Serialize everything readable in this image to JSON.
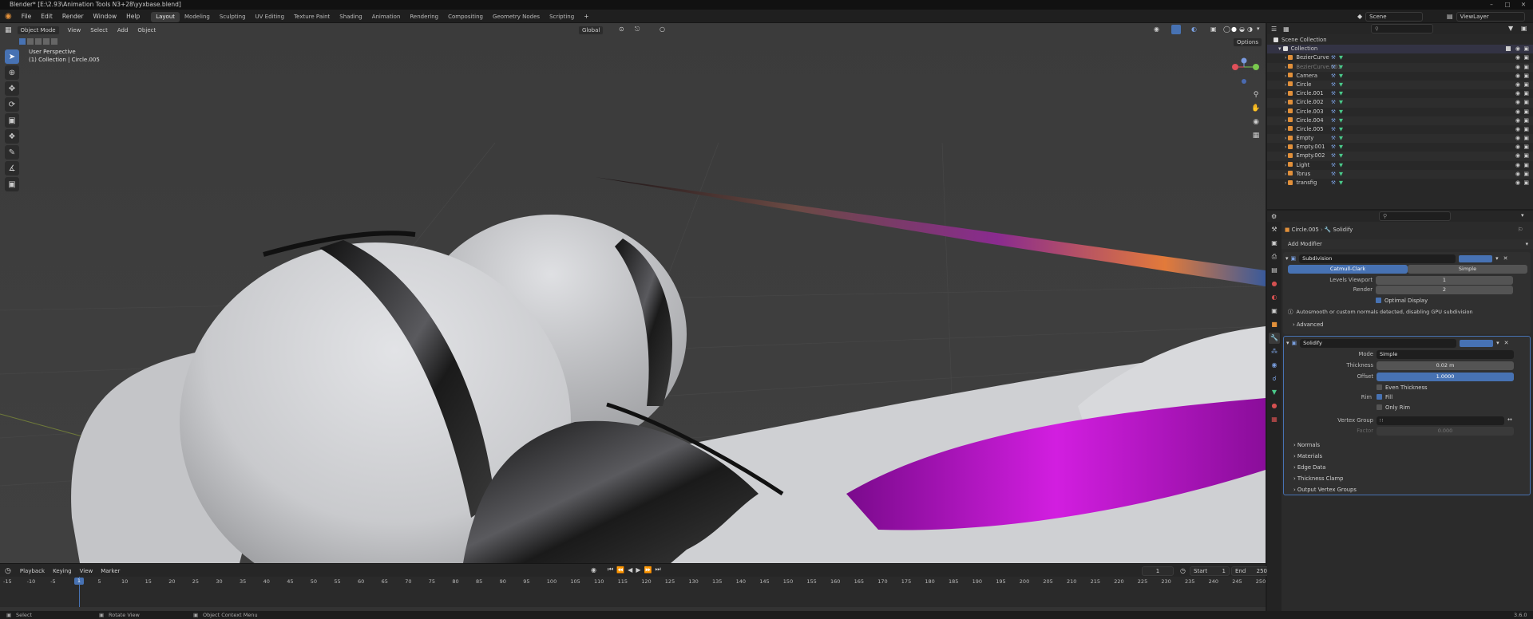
{
  "title": "Blender* [E:\\2.93\\Animation Tools N3+28\\yyxbase.blend]",
  "menu": [
    "File",
    "Edit",
    "Render",
    "Window",
    "Help"
  ],
  "workspaces": [
    "Layout",
    "Modeling",
    "Sculpting",
    "UV Editing",
    "Texture Paint",
    "Shading",
    "Animation",
    "Rendering",
    "Compositing",
    "Geometry Nodes",
    "Scripting"
  ],
  "active_workspace": "Layout",
  "scene": "Scene",
  "view_layer": "ViewLayer",
  "viewport": {
    "mode": "Object Mode",
    "menus": [
      "View",
      "Select",
      "Add",
      "Object"
    ],
    "orientation": "Global",
    "perspective": "User Perspective",
    "collection_info": "(1) Collection | Circle.005",
    "options": "Options"
  },
  "outliner": {
    "root": "Scene Collection",
    "collection": "Collection",
    "items": [
      {
        "name": "BezierCurve",
        "color": "#e2903a"
      },
      {
        "name": "BezierCurve.001",
        "color": "#e2903a",
        "dim": true
      },
      {
        "name": "Camera",
        "color": "#e2903a"
      },
      {
        "name": "Circle",
        "color": "#e2903a"
      },
      {
        "name": "Circle.001",
        "color": "#e2903a"
      },
      {
        "name": "Circle.002",
        "color": "#e2903a"
      },
      {
        "name": "Circle.003",
        "color": "#e2903a"
      },
      {
        "name": "Circle.004",
        "color": "#e2903a"
      },
      {
        "name": "Circle.005",
        "color": "#e2903a"
      },
      {
        "name": "Empty",
        "color": "#e2903a"
      },
      {
        "name": "Empty.001",
        "color": "#e2903a"
      },
      {
        "name": "Empty.002",
        "color": "#e2903a"
      },
      {
        "name": "Light",
        "color": "#e2903a"
      },
      {
        "name": "Torus",
        "color": "#e2903a"
      },
      {
        "name": "transfig",
        "color": "#e2903a"
      }
    ]
  },
  "properties": {
    "breadcrumb_obj": "Circle.005",
    "breadcrumb_mod": "Solidify",
    "add_modifier": "Add Modifier",
    "subdiv": {
      "name": "Subdivision",
      "tab1": "Catmull-Clark",
      "tab2": "Simple",
      "levels_label": "Levels Viewport",
      "levels": "1",
      "render_label": "Render",
      "render": "2",
      "optimal": "Optimal Display",
      "warning": "Autosmooth or custom normals detected, disabling GPU subdivision",
      "advanced": "Advanced"
    },
    "solidify": {
      "name": "Solidify",
      "mode_label": "Mode",
      "mode": "Simple",
      "thickness_label": "Thickness",
      "thickness": "0.02 m",
      "offset_label": "Offset",
      "offset": "1.0000",
      "offset_fill": 1.0,
      "even": "Even Thickness",
      "rim_label": "Rim",
      "fill": "Fill",
      "only_rim": "Only Rim",
      "vgroup_label": "Vertex Group",
      "factor_label": "Factor",
      "factor": "0.000",
      "panels": [
        "Normals",
        "Materials",
        "Edge Data",
        "Thickness Clamp",
        "Output Vertex Groups"
      ]
    }
  },
  "timeline": {
    "menus": [
      "Playback",
      "Keying",
      "View",
      "Marker"
    ],
    "current": "1",
    "start_label": "Start",
    "start": "1",
    "end_label": "End",
    "end": "250",
    "ticks": [
      "-15",
      "-10",
      "-5",
      "1",
      "5",
      "10",
      "15",
      "20",
      "25",
      "30",
      "35",
      "40",
      "45",
      "50",
      "55",
      "60",
      "65",
      "70",
      "75",
      "80",
      "85",
      "90",
      "95",
      "100",
      "105",
      "110",
      "115",
      "120",
      "125",
      "130",
      "135",
      "140",
      "145",
      "150",
      "155",
      "160",
      "165",
      "170",
      "175",
      "180",
      "185",
      "190",
      "195",
      "200",
      "205",
      "210",
      "215",
      "220",
      "225",
      "230",
      "235",
      "240",
      "245",
      "250"
    ]
  },
  "status": {
    "select": "Select",
    "rotate": "Rotate View",
    "context": "Object Context Menu",
    "version": "3.6.0"
  }
}
